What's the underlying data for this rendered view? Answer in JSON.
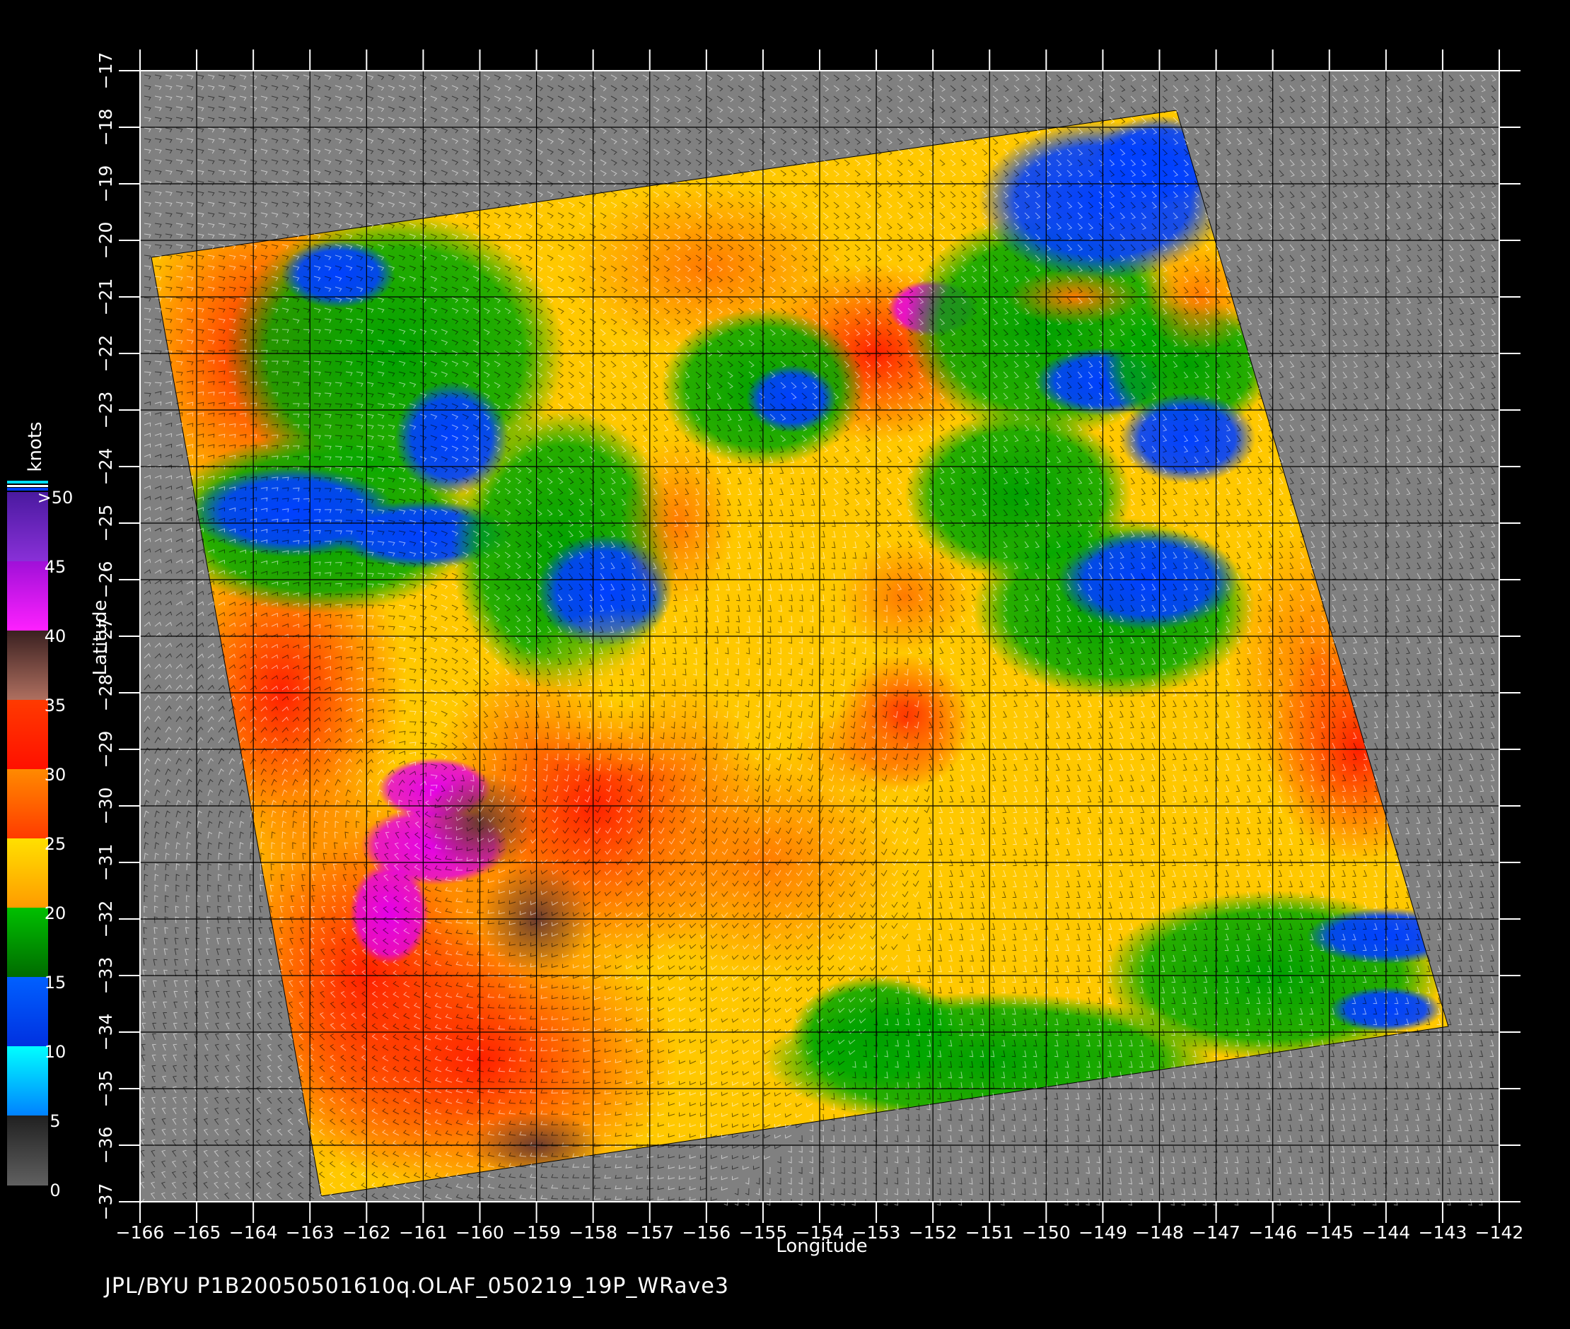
{
  "map": {
    "xlabel": "Longitude",
    "ylabel": "Latitude",
    "lon_ticks": [
      -166,
      -165,
      -164,
      -163,
      -162,
      -161,
      -160,
      -159,
      -158,
      -157,
      -156,
      -155,
      -154,
      -153,
      -152,
      -151,
      -150,
      -149,
      -148,
      -147,
      -146,
      -145,
      -144,
      -143,
      -142
    ],
    "lat_ticks": [
      -17,
      -18,
      -19,
      -20,
      -21,
      -22,
      -23,
      -24,
      -25,
      -26,
      -27,
      -28,
      -29,
      -30,
      -31,
      -32,
      -33,
      -34,
      -35,
      -36,
      -37
    ],
    "lon_range": [
      -166,
      -142
    ],
    "lat_range": [
      -37,
      -17
    ],
    "swath_corners_lonlat": [
      [
        -165.8,
        -20.3
      ],
      [
        -147.7,
        -17.7
      ],
      [
        -142.9,
        -33.9
      ],
      [
        -162.8,
        -36.9
      ]
    ],
    "cyclone_center_lonlat": [
      -160.8,
      -29.8
    ],
    "background_color": "#808080",
    "grid": true
  },
  "colorbar": {
    "title": "knots",
    "labels": [
      ">50",
      "45",
      "40",
      "35",
      "30",
      "25",
      "20",
      "15",
      "10",
      "5",
      "0"
    ],
    "colors": [
      "#7a1fc4",
      "#e400e8",
      "#6b3a2e",
      "#ff1a00",
      "#ff7a00",
      "#ffd200",
      "#00a800",
      "#0040ff",
      "#00e0ff",
      "#404040",
      "#8a8a8a"
    ]
  },
  "caption": "JPL/BYU  P1B20050501610q.OLAF_050219_19P_WRave3"
}
